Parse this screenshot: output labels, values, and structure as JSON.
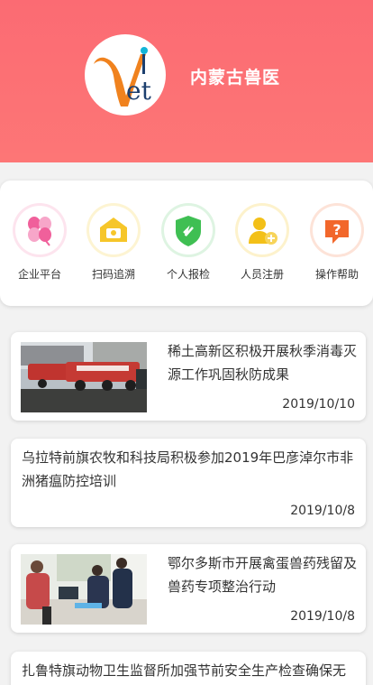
{
  "header": {
    "app_name": "内蒙古兽医",
    "logo_text": "Vet",
    "colors": {
      "header_bg": "#fb6b73",
      "logo_orange": "#f0821e",
      "logo_navy": "#1c3f6e",
      "logo_cyan": "#13b5d8"
    }
  },
  "menu": {
    "items": [
      {
        "label": "企业平台",
        "icon": "clover-icon",
        "color": "#f0609b"
      },
      {
        "label": "扫码追溯",
        "icon": "scan-trace-icon",
        "color": "#f6c62a"
      },
      {
        "label": "个人报检",
        "icon": "shield-check-icon",
        "color": "#3fbf53"
      },
      {
        "label": "人员注册",
        "icon": "user-add-icon",
        "color": "#f3c018"
      },
      {
        "label": "操作帮助",
        "icon": "help-bubble-icon",
        "color": "#f2672b"
      }
    ]
  },
  "news": [
    {
      "title": "稀土高新区积极开展秋季消毒灭源工作巩固秋防成果",
      "date": "2019/10/10",
      "has_image": true,
      "image": "disinfection-trucks-photo"
    },
    {
      "title": "乌拉特前旗农牧和科技局积极参加2019年巴彦淖尔市非洲猪瘟防控培训",
      "date": "2019/10/8",
      "has_image": false
    },
    {
      "title": "鄂尔多斯市开展禽蛋兽药残留及兽药专项整治行动",
      "date": "2019/10/8",
      "has_image": true,
      "image": "inspection-office-photo"
    },
    {
      "title": "扎鲁特旗动物卫生监督所加强节前安全生产检查确保无",
      "date": "",
      "has_image": false
    }
  ]
}
